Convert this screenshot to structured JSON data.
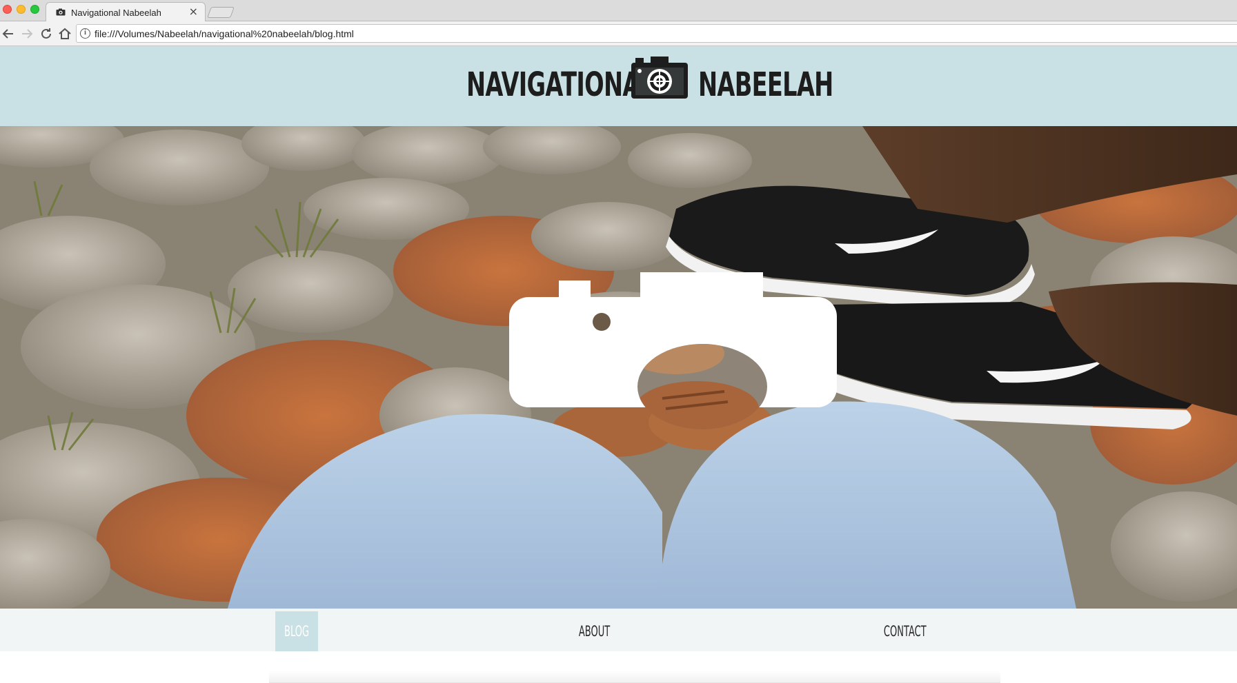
{
  "browser": {
    "tab_title": "Navigational Nabeelah",
    "tab_close": "×",
    "url": "file:///Volumes/Nabeelah/navigational%20nabeelah/blog.html",
    "icons": [
      "back-arrow-icon",
      "forward-arrow-icon",
      "reload-icon",
      "home-icon",
      "info-icon"
    ]
  },
  "header": {
    "logo_left": "NAVIGATIONAL",
    "logo_right": "NABEELAH",
    "background": "#c9e0e5"
  },
  "hero": {
    "overlay_icon": "camera-icon"
  },
  "nav": {
    "items": [
      {
        "label": "BLOG",
        "active": true
      },
      {
        "label": "ABOUT",
        "active": false
      },
      {
        "label": "CONTACT",
        "active": false
      }
    ],
    "active_color": "#c9e0e5"
  }
}
